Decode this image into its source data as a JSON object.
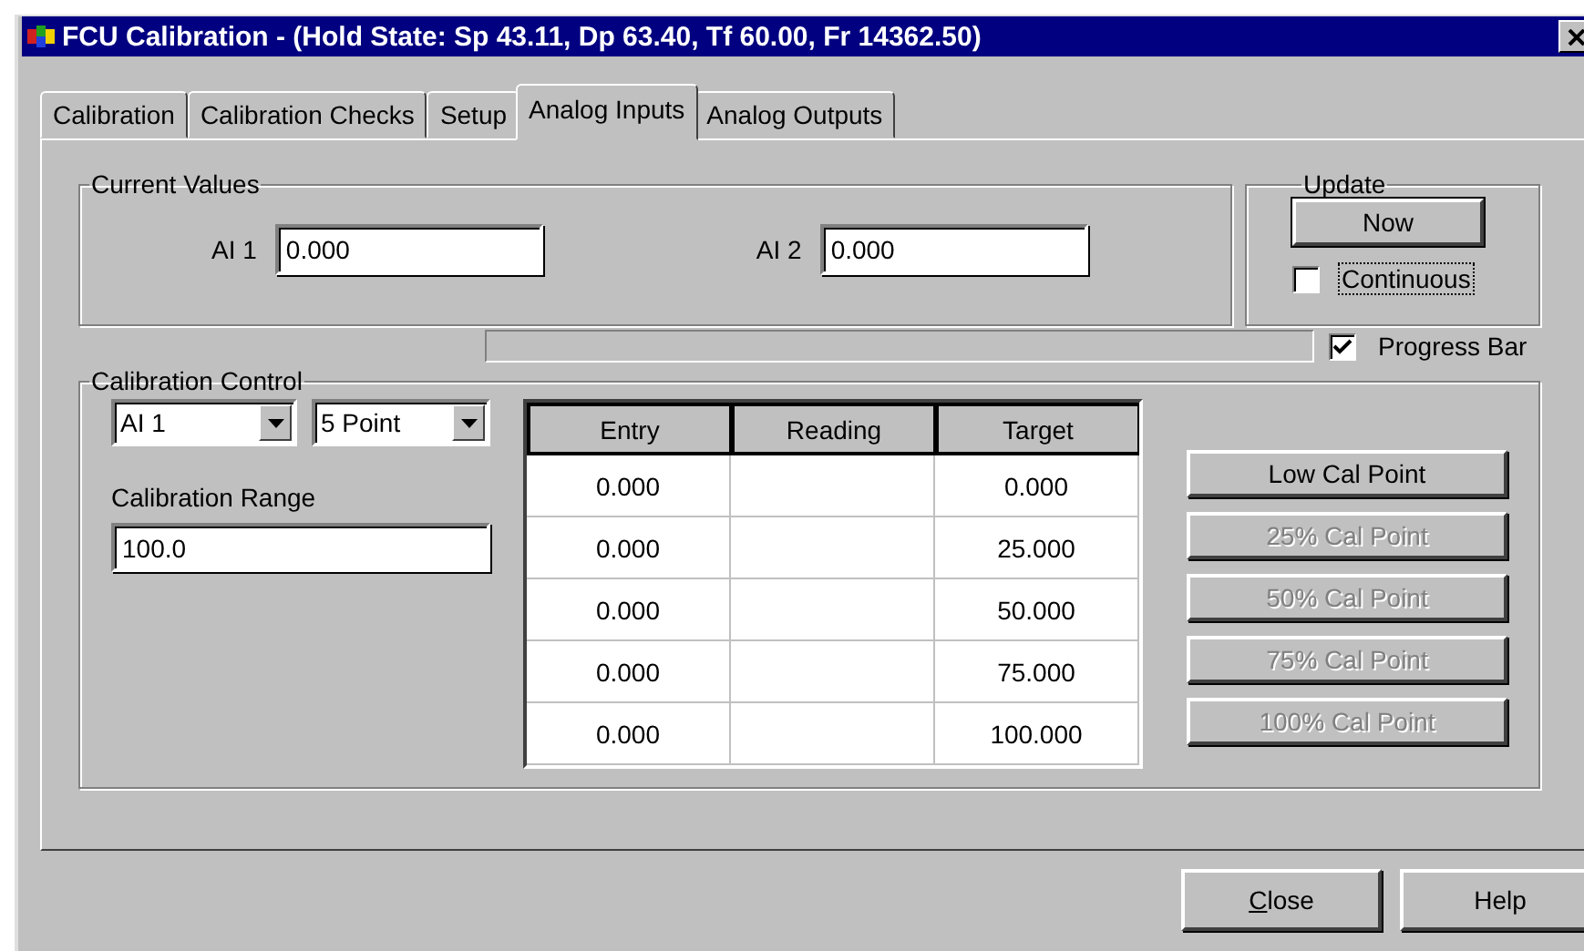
{
  "window": {
    "title": "FCU Calibration - (Hold State: Sp 43.11, Dp 63.40, Tf 60.00, Fr 14362.50)"
  },
  "tabs": [
    {
      "label": "Calibration",
      "selected": false
    },
    {
      "label": "Calibration Checks",
      "selected": false
    },
    {
      "label": "Setup",
      "selected": false
    },
    {
      "label": "Analog Inputs",
      "selected": true
    },
    {
      "label": "Analog Outputs",
      "selected": false
    }
  ],
  "current_values": {
    "title": "Current Values",
    "inputs": [
      {
        "label": "AI 1",
        "value": "0.000"
      },
      {
        "label": "AI 2",
        "value": "0.000"
      }
    ]
  },
  "update": {
    "title": "Update",
    "now_button": "Now",
    "continuous": {
      "label": "Continuous",
      "checked": false,
      "focused": true
    }
  },
  "progress_bar_option": {
    "label": "Progress Bar",
    "checked": true
  },
  "calibration_control": {
    "title": "Calibration Control",
    "input_select": "AI 1",
    "points_select": "5 Point",
    "range_label": "Calibration Range",
    "range_value": "100.0",
    "table": {
      "columns": [
        "Entry",
        "Reading",
        "Target"
      ],
      "rows": [
        {
          "entry": "0.000",
          "target": "0.000"
        },
        {
          "entry": "0.000",
          "target": "25.000"
        },
        {
          "entry": "0.000",
          "target": "50.000"
        },
        {
          "entry": "0.000",
          "target": "75.000"
        },
        {
          "entry": "0.000",
          "target": "100.000"
        }
      ]
    },
    "buttons": [
      {
        "label": "Low Cal Point",
        "disabled": false
      },
      {
        "label": "25% Cal Point",
        "disabled": true
      },
      {
        "label": "50% Cal Point",
        "disabled": true
      },
      {
        "label": "75% Cal Point",
        "disabled": true
      },
      {
        "label": "100% Cal Point",
        "disabled": true
      }
    ]
  },
  "buttons": [
    {
      "label": "Close",
      "underline_first": true
    },
    {
      "label": "Help",
      "underline_first": false
    }
  ]
}
